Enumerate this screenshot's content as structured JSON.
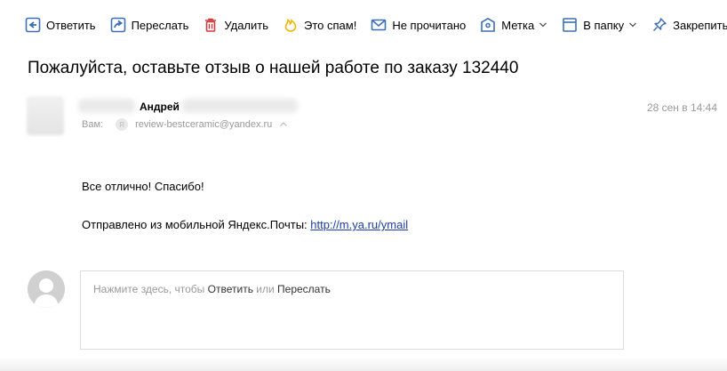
{
  "toolbar": {
    "reply_label": "Ответить",
    "forward_label": "Переслать",
    "delete_label": "Удалить",
    "spam_label": "Это спам!",
    "unread_label": "Не прочитано",
    "tag_label": "Метка",
    "folder_label": "В папку",
    "pin_label": "Закрепить"
  },
  "message": {
    "subject": "Пожалуйста, оставьте отзыв о нашей работе по заказу 132440",
    "sender_name": "Андрей",
    "to_label": "Вам:",
    "to_avatar_letter": "R",
    "to_email": "review-bestceramic@yandex.ru",
    "date": "28 сен в 14:44",
    "body_line1": "Все отлично! Спасибо!",
    "body_line2_prefix": "Отправлено из мобильной Яндекс.Почты: ",
    "body_link": "http://m.ya.ru/ymail"
  },
  "reply": {
    "prompt_prefix": "Нажмите здесь, чтобы ",
    "reply_link": "Ответить",
    "or_text": " или ",
    "forward_link": "Переслать"
  },
  "icons": {
    "accent": "#3b6fb6",
    "delete": "#d23c3c",
    "spam": "#f2b600"
  }
}
